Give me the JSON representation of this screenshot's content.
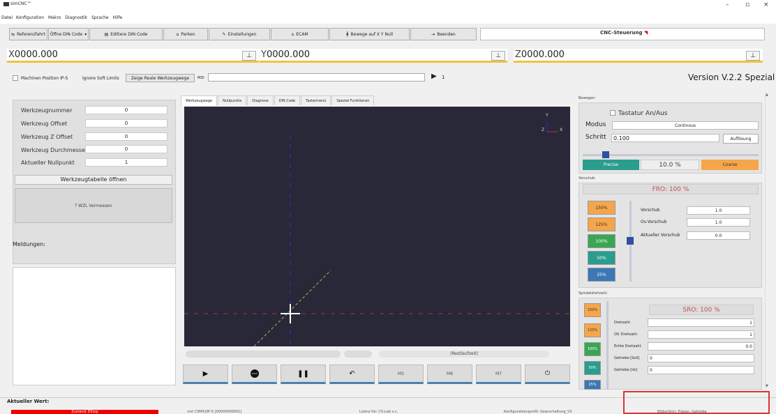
{
  "app": {
    "title": "simCNC™"
  },
  "menu": [
    "Datei",
    "Konfiguration",
    "Makro",
    "Diagnostik",
    "Sprache",
    "Hilfe"
  ],
  "toolbar": {
    "ref": "Referenzfahrt",
    "open": "Öffne DIN Code",
    "edit": "Editiere DIN Code",
    "park": "Parken",
    "settings": "Einstellungen",
    "ecam": "ECAM",
    "move_xy": "Bewege auf X Y Null",
    "exit": "Beenden"
  },
  "logo": {
    "text": "CNC-Steuerung"
  },
  "coords": {
    "x_label": "X",
    "x_value": "0000.000",
    "y_label": "Y",
    "y_value": "0000.000",
    "z_label": "Z",
    "z_value": "0000.000"
  },
  "options": {
    "machine_pos": "Machinen Position IP-S",
    "ignore_limits": "Ignore Soft Limits",
    "show_paths": "Zeige Reale Werkzeugwege",
    "mdi_label": "MDI",
    "mdi_count": "1"
  },
  "version": "Version V.2.2 Spezial",
  "tool": {
    "rows": [
      {
        "label": "Werkzeugnummer",
        "value": "0"
      },
      {
        "label": "Werkzeug Offset",
        "value": "0"
      },
      {
        "label": "Werkzeug Z Offset",
        "value": "0"
      },
      {
        "label": "Werkzeug Durchmesser",
        "value": "0"
      },
      {
        "label": "Aktueller Nullpunkt",
        "value": "1"
      }
    ],
    "table_btn": "Werkzeugtabelle öffnen",
    "measure_btn": "WZL Vermessen"
  },
  "messages_label": "Meldungen:",
  "tabs": [
    "Werkzeugwege",
    "Nullpunkte",
    "Diagnose",
    "DIN Code",
    "Tastermenü",
    "Spezial Funktionen"
  ],
  "view": {
    "axis_y": "Y",
    "axis_z": "Z",
    "axis_x": "X"
  },
  "rest_label": "(Restlaufzeit)",
  "controls": {
    "m3": "M3",
    "m8": "M8",
    "m7": "M7",
    "stop": "STOP"
  },
  "move": {
    "section": "Bewegen:",
    "keyboard": "Tastatur An/Aus",
    "mode_label": "Modus",
    "mode_value": "Continous",
    "step_label": "Schritt",
    "step_value": "0.100",
    "resolution_btn": "Auflösung",
    "precise": "Precise",
    "percent": "10.0 %",
    "coarse": "Coarse",
    "slider_level": 0.1
  },
  "feed": {
    "section": "Vorschub:",
    "fro": "FRO: 100 %",
    "buttons": [
      "150%",
      "125%",
      "100%",
      "50%",
      "25%"
    ],
    "rows": [
      {
        "label": "Vorschub",
        "value": "1.0"
      },
      {
        "label": "Ov.Vorschub",
        "value": "1.0"
      },
      {
        "label": "Aktueller Vorschub",
        "value": "0.0"
      }
    ]
  },
  "spindle": {
    "section": "Spindeldrehzahl:",
    "sro": "SRO: 100 %",
    "buttons": [
      "150%",
      "125%",
      "100%",
      "50%",
      "25%"
    ],
    "rows": [
      {
        "label": "Drehzahl:",
        "value": "1"
      },
      {
        "label": "OV. Drehzahl:",
        "value": "1"
      },
      {
        "label": "Echte Drehzahl:",
        "value": "0.0"
      },
      {
        "label": "Getriebe [Soll]",
        "value": "0"
      },
      {
        "label": "Getriebe [Ist]",
        "value": "0"
      }
    ]
  },
  "status": {
    "current_label": "Aktueller Wert:",
    "estop": "Zustand: EStop",
    "device": "vist CSMIO/IP-S [00000000001]",
    "license": "Lizenz für: CS-Lab s.c.",
    "profile": "Konfigurationsprofil: Gearschaltung_V2",
    "mode": "Bildschirm: Fräsen, Getriebe"
  },
  "colors": {
    "accent": "#f2c23c",
    "precise": "#2a9d8f",
    "coarse": "#f5a54a",
    "estop": "#e00000"
  }
}
